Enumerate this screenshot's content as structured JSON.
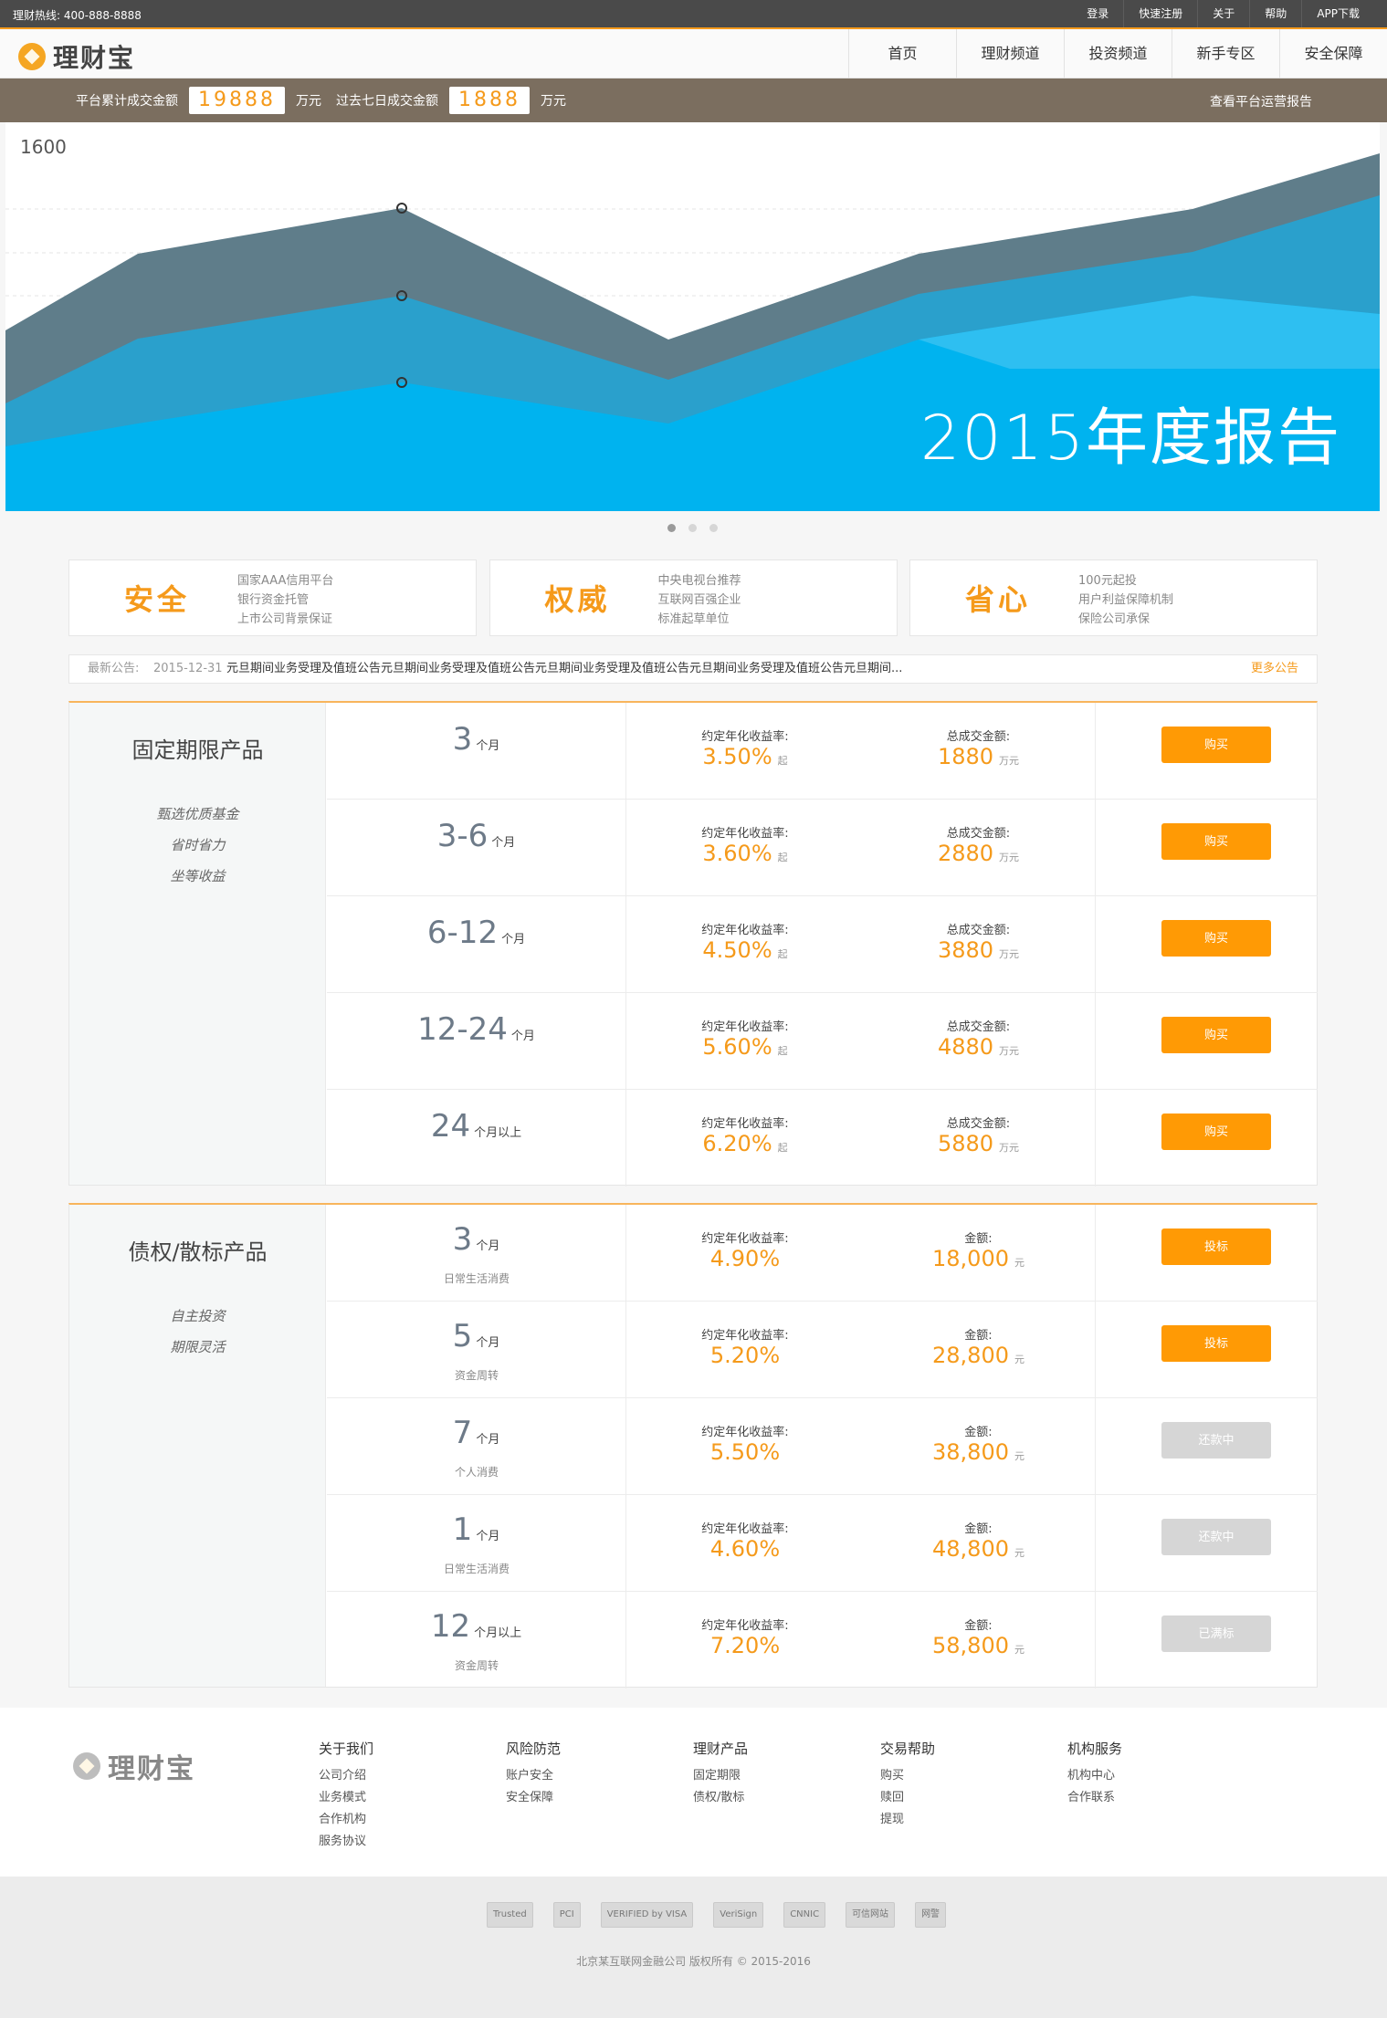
{
  "topbar": {
    "hotline": "理财热线: 400-888-8888",
    "links": [
      "登录",
      "快速注册",
      "关于",
      "帮助",
      "APP下载"
    ]
  },
  "header": {
    "logo_text": "理财宝",
    "nav": [
      "首页",
      "理财频道",
      "投资频道",
      "新手专区",
      "安全保障"
    ]
  },
  "stats": {
    "total_label": "平台累计成交金额",
    "total_value": "19888",
    "total_unit": "万元",
    "week_label": "过去七日成交金额",
    "week_value": "1888",
    "week_unit": "万元",
    "report_link": "查看平台运营报告"
  },
  "banner": {
    "y_label": "1600",
    "title": "2015年度报告",
    "colors": {
      "dark": "#5f7d8a",
      "mid": "#2aa0cc",
      "light": "#00b3ef"
    }
  },
  "features": [
    {
      "title": "安全",
      "lines": [
        "国家AAA信用平台",
        "银行资金托管",
        "上市公司背景保证"
      ]
    },
    {
      "title": "权威",
      "lines": [
        "中央电视台推荐",
        "互联网百强企业",
        "标准起草单位"
      ]
    },
    {
      "title": "省心",
      "lines": [
        "100元起投",
        "用户利益保障机制",
        "保险公司承保"
      ]
    }
  ],
  "notice": {
    "label": "最新公告:",
    "date": "2015-12-31",
    "text": "元旦期间业务受理及值班公告元旦期间业务受理及值班公告元旦期间业务受理及值班公告元旦期间业务受理及值班公告元旦期间...",
    "more": "更多公告"
  },
  "fixed": {
    "title": "固定期限产品",
    "tags": [
      "甄选优质基金",
      "省时省力",
      "坐等收益"
    ],
    "rate_label": "约定年化收益率:",
    "amount_label": "总成交金额:",
    "rate_suffix": "起",
    "amount_unit": "万元",
    "rows": [
      {
        "term": "3",
        "unit": "个月",
        "rate": "3.50%",
        "amount": "1880",
        "button": "购买"
      },
      {
        "term": "3-6",
        "unit": "个月",
        "rate": "3.60%",
        "amount": "2880",
        "button": "购买"
      },
      {
        "term": "6-12",
        "unit": "个月",
        "rate": "4.50%",
        "amount": "3880",
        "button": "购买"
      },
      {
        "term": "12-24",
        "unit": "个月",
        "rate": "5.60%",
        "amount": "4880",
        "button": "购买"
      },
      {
        "term": "24",
        "unit": "个月以上",
        "rate": "6.20%",
        "amount": "5880",
        "button": "购买"
      }
    ]
  },
  "debt": {
    "title": "债权/散标产品",
    "tags": [
      "自主投资",
      "期限灵活"
    ],
    "rate_label": "约定年化收益率:",
    "amount_label": "金额:",
    "amount_unit": "元",
    "rows": [
      {
        "term": "3",
        "unit": "个月",
        "sub": "日常生活消费",
        "rate": "4.90%",
        "amount": "18,000",
        "button": "投标",
        "active": true
      },
      {
        "term": "5",
        "unit": "个月",
        "sub": "资金周转",
        "rate": "5.20%",
        "amount": "28,800",
        "button": "投标",
        "active": true
      },
      {
        "term": "7",
        "unit": "个月",
        "sub": "个人消费",
        "rate": "5.50%",
        "amount": "38,800",
        "button": "还款中",
        "active": false
      },
      {
        "term": "1",
        "unit": "个月",
        "sub": "日常生活消费",
        "rate": "4.60%",
        "amount": "48,800",
        "button": "还款中",
        "active": false
      },
      {
        "term": "12",
        "unit": "个月以上",
        "sub": "资金周转",
        "rate": "7.20%",
        "amount": "58,800",
        "button": "已满标",
        "active": false
      }
    ]
  },
  "footer": {
    "logo_text": "理财宝",
    "columns": [
      {
        "heading": "关于我们",
        "links": [
          "公司介绍",
          "业务模式",
          "合作机构",
          "服务协议"
        ]
      },
      {
        "heading": "风险防范",
        "links": [
          "账户安全",
          "安全保障"
        ]
      },
      {
        "heading": "理财产品",
        "links": [
          "固定期限",
          "债权/散标"
        ]
      },
      {
        "heading": "交易帮助",
        "links": [
          "购买",
          "赎回",
          "提现"
        ]
      },
      {
        "heading": "机构服务",
        "links": [
          "机构中心",
          "合作联系"
        ]
      }
    ],
    "badges": [
      "Trusted",
      "PCI",
      "VERIFIED by VISA",
      "VeriSign",
      "CNNIC",
      "可信网站",
      "网警"
    ],
    "copyright": "北京某互联网金融公司 版权所有 © 2015-2016"
  },
  "accent_color": "#f59a1b"
}
